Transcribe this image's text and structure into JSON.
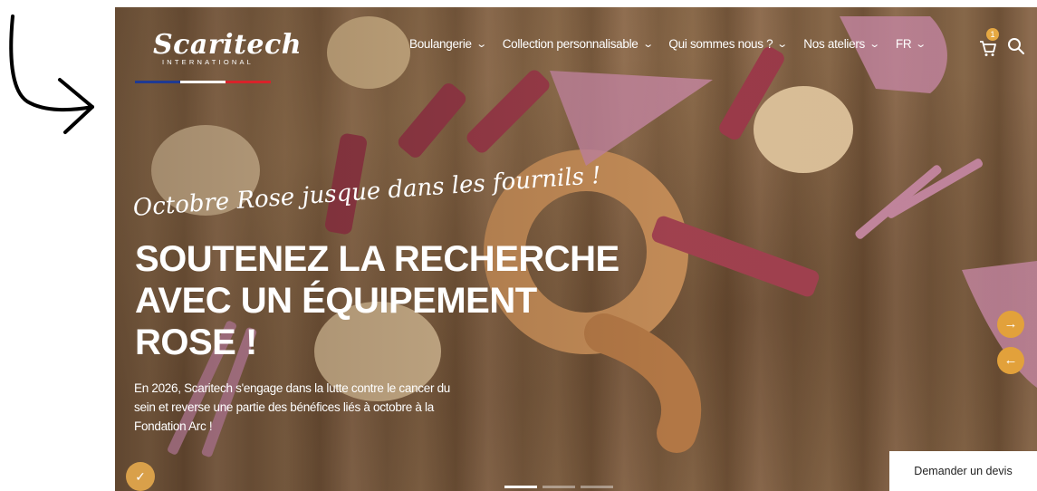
{
  "logo": {
    "name": "Scaritech",
    "sub": "INTERNATIONAL"
  },
  "nav": {
    "items": [
      {
        "label": "Boulangerie"
      },
      {
        "label": "Collection personnalisable"
      },
      {
        "label": "Qui sommes nous ?"
      },
      {
        "label": "Nos ateliers"
      },
      {
        "label": "FR"
      }
    ],
    "cart_count": "1"
  },
  "hero": {
    "tagline": "Octobre Rose jusque dans les fournils !",
    "headline": "SOUTENEZ LA RECHERCHE AVEC UN ÉQUIPEMENT ROSE !",
    "body": "En 2026, Scaritech s'engage dans la lutte contre le cancer du sein et reverse une partie des bénéfices liés à octobre à la Fondation Arc !",
    "next_symbol": "→",
    "prev_symbol": "←"
  },
  "cta": {
    "quote_button": "Demander un devis"
  },
  "cookie_symbol": "✓",
  "colors": {
    "accent": "#e2a13b",
    "pink": "#e89ab8",
    "flag_blue": "#1f3a93",
    "flag_red": "#d8232a"
  },
  "icons": [
    "curved-arrow-icon",
    "chevron-down-icon",
    "cart-icon",
    "search-icon",
    "arrow-right-icon",
    "arrow-left-icon",
    "cookie-icon"
  ]
}
